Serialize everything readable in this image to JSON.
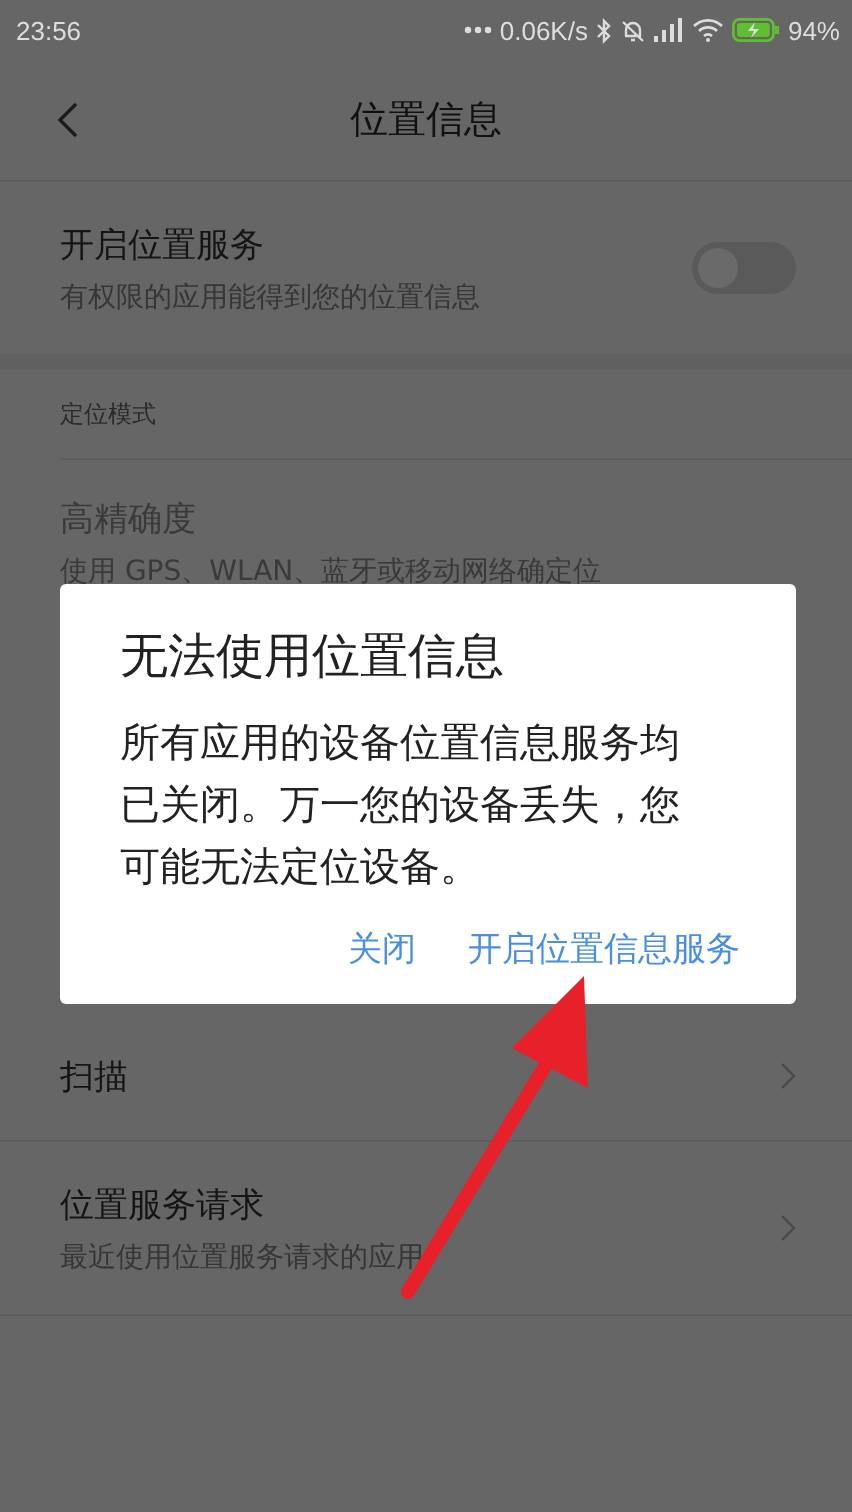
{
  "status_bar": {
    "time": "23:56",
    "net_speed": "0.06K/s",
    "battery": "94%"
  },
  "header": {
    "title": "位置信息"
  },
  "location_service": {
    "title": "开启位置服务",
    "subtitle": "有权限的应用能得到您的位置信息",
    "on": false
  },
  "section_title": "定位模式",
  "mode_item": {
    "title": "高精确度",
    "subtitle": "使用 GPS、WLAN、蓝牙或移动网络确定位"
  },
  "items": [
    {
      "title": "扫描"
    },
    {
      "title": "位置服务请求",
      "subtitle": "最近使用位置服务请求的应用"
    }
  ],
  "dialog": {
    "title": "无法使用位置信息",
    "message": "所有应用的设备位置信息服务均已关闭。万一您的设备丢失，您可能无法定位设备。",
    "buttons": [
      "关闭",
      "开启位置信息服务"
    ]
  }
}
